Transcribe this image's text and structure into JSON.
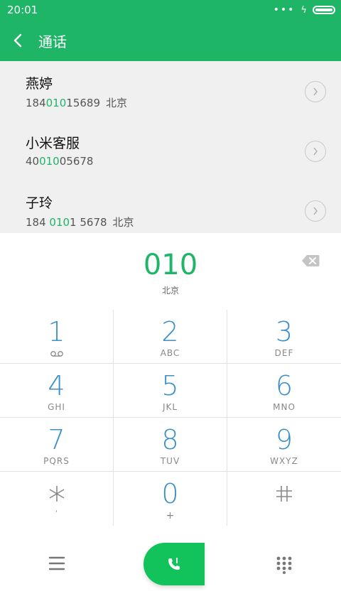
{
  "status_bar": {
    "time": "20:01",
    "dots": "•••",
    "bolt": "ϟ"
  },
  "header": {
    "title": "通话"
  },
  "contacts": [
    {
      "name": "燕婷",
      "number_pre": "184",
      "number_hl": "010",
      "number_post": "15689",
      "location": "北京"
    },
    {
      "name": "小米客服",
      "number_pre": "40",
      "number_hl": "010",
      "number_post": "05678",
      "location": ""
    },
    {
      "name": "子玲",
      "number_pre": "184 ",
      "number_hl": "010",
      "number_post": "1 5678",
      "location": "北京"
    }
  ],
  "dialer": {
    "digits": "010",
    "location": "北京"
  },
  "keys": [
    {
      "digit": "1",
      "letters": ""
    },
    {
      "digit": "2",
      "letters": "ABC"
    },
    {
      "digit": "3",
      "letters": "DEF"
    },
    {
      "digit": "4",
      "letters": "GHI"
    },
    {
      "digit": "5",
      "letters": "JKL"
    },
    {
      "digit": "6",
      "letters": "MNO"
    },
    {
      "digit": "7",
      "letters": "PQRS"
    },
    {
      "digit": "8",
      "letters": "TUV"
    },
    {
      "digit": "9",
      "letters": "WXYZ"
    },
    {
      "digit": "*",
      "letters": ""
    },
    {
      "digit": "0",
      "letters": "+"
    },
    {
      "digit": "#",
      "letters": ""
    }
  ],
  "colors": {
    "brand": "#1fb566",
    "key_digit": "#3b8fc6",
    "call": "#12c25a"
  },
  "icons": {
    "back": "back-arrow-icon",
    "chevron": "chevron-right-icon",
    "backspace": "backspace-icon",
    "voicemail": "voicemail-icon",
    "menu": "menu-icon",
    "call": "phone-call-icon",
    "dialpad": "dialpad-icon"
  }
}
